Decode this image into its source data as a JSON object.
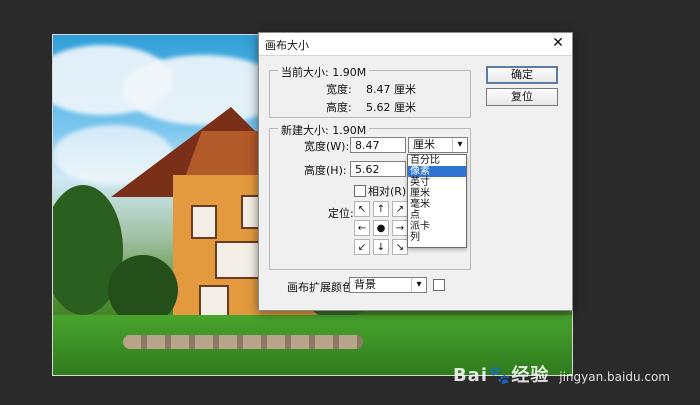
{
  "dialog": {
    "title": "画布大小",
    "close_glyph": "✕",
    "current_size": {
      "legend": "当前大小: 1.90M",
      "width_label": "宽度:",
      "width_value": "8.47 厘米",
      "height_label": "高度:",
      "height_value": "5.62 厘米"
    },
    "new_size": {
      "legend": "新建大小: 1.90M",
      "width_label": "宽度(W):",
      "width_value": "8.47",
      "unit_selected": "厘米",
      "height_label": "高度(H):",
      "height_value": "5.62",
      "relative_label": "相对(R)",
      "anchor_label": "定位:"
    },
    "unit_options": [
      "百分比",
      "像素",
      "英寸",
      "厘米",
      "毫米",
      "点",
      "派卡",
      "列"
    ],
    "unit_options_highlight_index": 1,
    "buttons": {
      "ok": "确定",
      "reset": "复位"
    },
    "canvas_extension": {
      "label": "画布扩展颜色:",
      "value": "背景"
    }
  },
  "anchor_glyphs": [
    "↖",
    "↑",
    "↗",
    "←",
    "●",
    "→",
    "↙",
    "↓",
    "↘"
  ],
  "watermark": {
    "brand": "Bai🐾经验",
    "site": "jingyan.baidu.com"
  }
}
